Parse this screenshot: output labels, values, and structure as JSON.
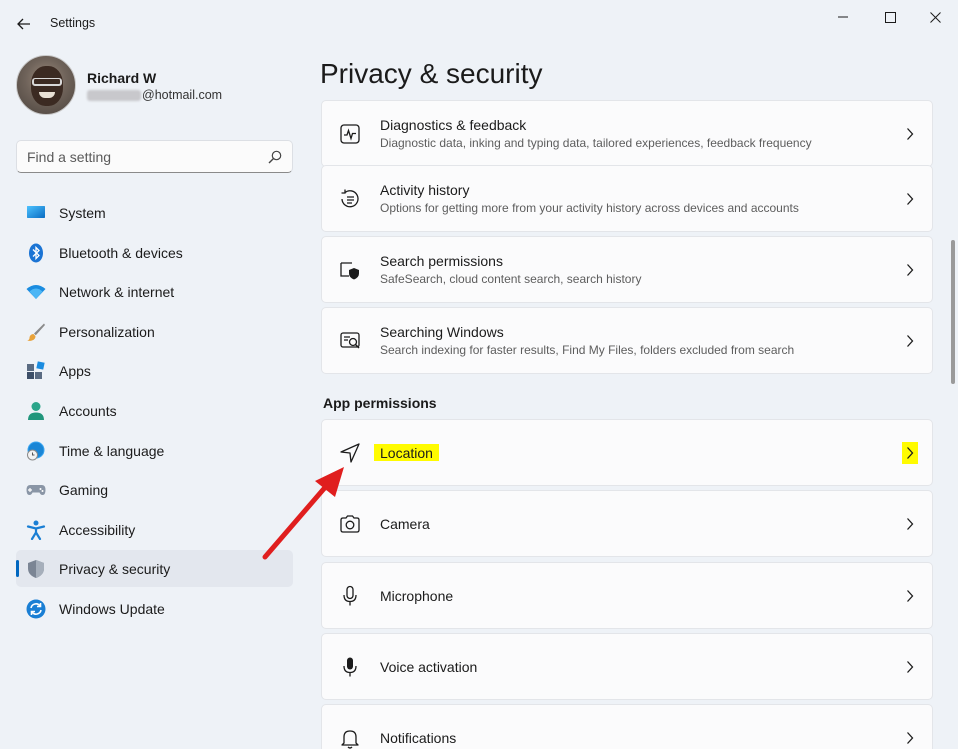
{
  "window": {
    "title": "Settings"
  },
  "profile": {
    "name": "Richard W",
    "email_visible": "@hotmail.com"
  },
  "search": {
    "placeholder": "Find a setting"
  },
  "sidebar": {
    "items": [
      {
        "label": "System",
        "icon": "system-icon"
      },
      {
        "label": "Bluetooth & devices",
        "icon": "bluetooth-icon"
      },
      {
        "label": "Network & internet",
        "icon": "wifi-icon"
      },
      {
        "label": "Personalization",
        "icon": "brush-icon"
      },
      {
        "label": "Apps",
        "icon": "apps-icon"
      },
      {
        "label": "Accounts",
        "icon": "account-icon"
      },
      {
        "label": "Time & language",
        "icon": "globe-clock-icon"
      },
      {
        "label": "Gaming",
        "icon": "gamepad-icon"
      },
      {
        "label": "Accessibility",
        "icon": "accessibility-icon"
      },
      {
        "label": "Privacy & security",
        "icon": "shield-icon",
        "active": true
      },
      {
        "label": "Windows Update",
        "icon": "update-icon"
      }
    ]
  },
  "main": {
    "title": "Privacy & security",
    "cards": [
      {
        "title": "Diagnostics & feedback",
        "subtitle": "Diagnostic data, inking and typing data, tailored experiences, feedback frequency",
        "icon": "diagnostics-icon"
      },
      {
        "title": "Activity history",
        "subtitle": "Options for getting more from your activity history across devices and accounts",
        "icon": "activity-history-icon"
      },
      {
        "title": "Search permissions",
        "subtitle": "SafeSearch, cloud content search, search history",
        "icon": "search-permissions-icon"
      },
      {
        "title": "Searching Windows",
        "subtitle": "Search indexing for faster results, Find My Files, folders excluded from search",
        "icon": "searching-windows-icon"
      }
    ],
    "section_heading": "App permissions",
    "permissions": [
      {
        "title": "Location",
        "icon": "location-icon",
        "highlighted": true
      },
      {
        "title": "Camera",
        "icon": "camera-icon"
      },
      {
        "title": "Microphone",
        "icon": "microphone-icon"
      },
      {
        "title": "Voice activation",
        "icon": "voice-activation-icon"
      },
      {
        "title": "Notifications",
        "icon": "bell-icon"
      }
    ]
  },
  "colors": {
    "accent": "#0067c0",
    "highlight": "#fffb00",
    "annotation_arrow": "#e01e1e"
  }
}
